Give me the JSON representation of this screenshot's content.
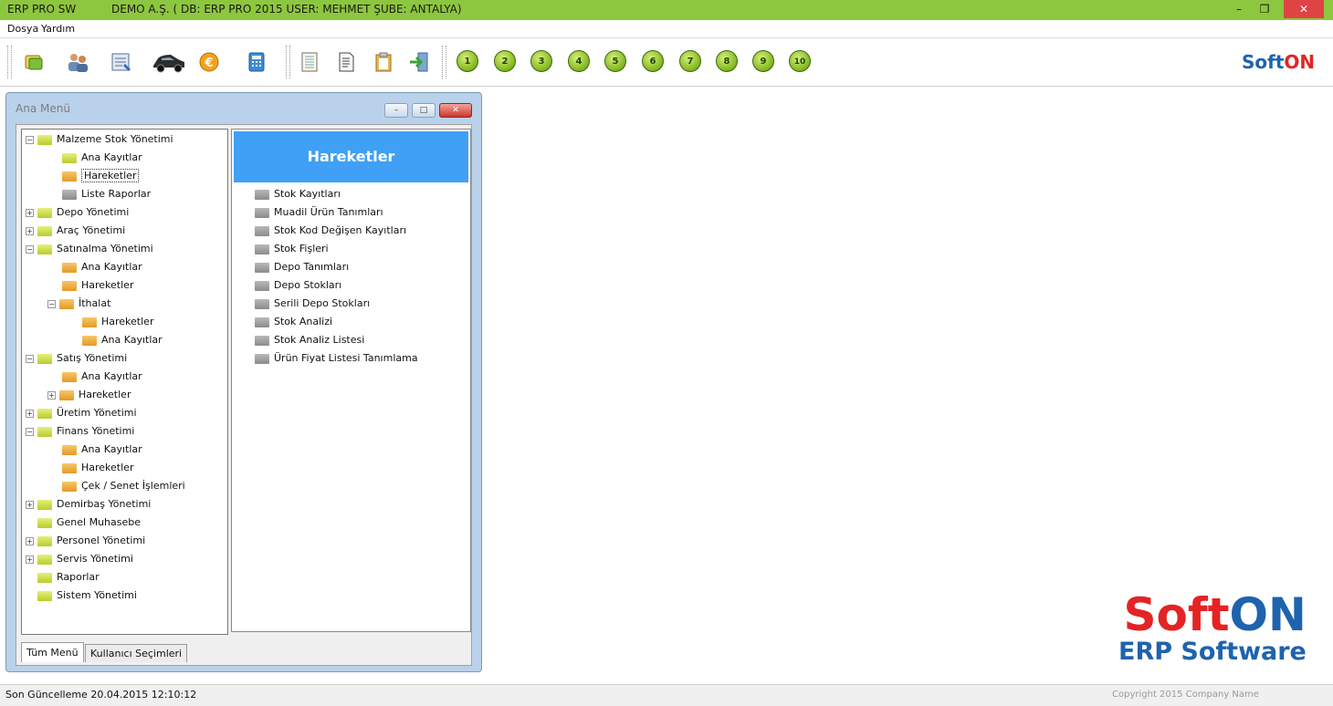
{
  "titlebar": {
    "app": "ERP PRO SW",
    "info": "DEMO A.Ş.  ( DB: ERP PRO 2015  USER: MEHMET  ŞUBE: ANTALYA)",
    "min_glyph": "–",
    "max_glyph": "❐",
    "close_glyph": "✕"
  },
  "menubar": {
    "items": [
      "Dosya",
      "Yardım"
    ]
  },
  "toolbar": {
    "icons": [
      "money-icon",
      "users-icon",
      "calendar-icon",
      "car-icon",
      "euro-icon",
      "calculator-icon",
      "notebook-icon",
      "document-icon",
      "clipboard-icon",
      "exit-icon"
    ],
    "numbers": [
      "1",
      "2",
      "3",
      "4",
      "5",
      "6",
      "7",
      "8",
      "9",
      "10"
    ],
    "brand_soft": "Soft",
    "brand_on": "ON"
  },
  "window": {
    "title": "Ana Menü",
    "btn_min": "–",
    "btn_max": "□",
    "btn_close": "✕"
  },
  "tree": [
    {
      "label": "Malzeme Stok Yönetimi",
      "exp": "⊟",
      "color": "g"
    },
    {
      "label": "Ana Kayıtlar",
      "exp": "",
      "color": "g"
    },
    {
      "label": "Hareketler",
      "exp": "",
      "color": "o"
    },
    {
      "label": "Liste Raporlar",
      "exp": "",
      "color": "gr"
    },
    {
      "label": "Depo Yönetimi",
      "exp": "⊞",
      "color": "g"
    },
    {
      "label": "Araç Yönetimi",
      "exp": "⊞",
      "color": "g"
    },
    {
      "label": "Satınalma Yönetimi",
      "exp": "⊟",
      "color": "g"
    },
    {
      "label": "Ana Kayıtlar",
      "exp": "",
      "color": "o"
    },
    {
      "label": "Hareketler",
      "exp": "",
      "color": "o"
    },
    {
      "label": "İthalat",
      "exp": "⊟",
      "color": "o"
    },
    {
      "label": "Hareketler",
      "exp": "",
      "color": "o"
    },
    {
      "label": "Ana Kayıtlar",
      "exp": "",
      "color": "o"
    },
    {
      "label": "Satış Yönetimi",
      "exp": "⊟",
      "color": "g"
    },
    {
      "label": "Ana Kayıtlar",
      "exp": "",
      "color": "o"
    },
    {
      "label": "Hareketler",
      "exp": "⊞",
      "color": "o"
    },
    {
      "label": "Üretim Yönetimi",
      "exp": "⊞",
      "color": "g"
    },
    {
      "label": "Finans Yönetimi",
      "exp": "⊟",
      "color": "g"
    },
    {
      "label": "Ana Kayıtlar",
      "exp": "",
      "color": "o"
    },
    {
      "label": "Hareketler",
      "exp": "",
      "color": "o"
    },
    {
      "label": "Çek / Senet İşlemleri",
      "exp": "",
      "color": "o"
    },
    {
      "label": "Demirbaş Yönetimi",
      "exp": "⊞",
      "color": "g"
    },
    {
      "label": "Genel Muhasebe",
      "exp": "",
      "color": "g"
    },
    {
      "label": "Personel Yönetimi",
      "exp": "⊞",
      "color": "g"
    },
    {
      "label": "Servis Yönetimi",
      "exp": "⊞",
      "color": "g"
    },
    {
      "label": "Raporlar",
      "exp": "",
      "color": "g"
    },
    {
      "label": "Sistem Yönetimi",
      "exp": "",
      "color": "g"
    }
  ],
  "panel": {
    "header": "Hareketler",
    "items": [
      "Stok Kayıtları",
      "Muadil Ürün Tanımları",
      "Stok Kod Değişen Kayıtları",
      "Stok Fişleri",
      "Depo Tanımları",
      "Depo Stokları",
      "Serili Depo Stokları",
      "Stok Analizi",
      "Stok Analiz Listesi",
      "Ürün Fiyat Listesi Tanımlama"
    ]
  },
  "tabs": [
    "Tüm Menü",
    "Kullanıcı Seçimleri"
  ],
  "logo": {
    "soft": "Soft",
    "on": "ON",
    "sub": "ERP Software"
  },
  "status": {
    "left": "Son Güncelleme 20.04.2015 12:10:12",
    "right": "Copyright 2015  Company Name"
  },
  "colors": {
    "titlebar": "#8dc63f",
    "panel_header": "#3fa0f5",
    "brand_blue": "#1e63ad",
    "brand_red": "#e42324"
  }
}
